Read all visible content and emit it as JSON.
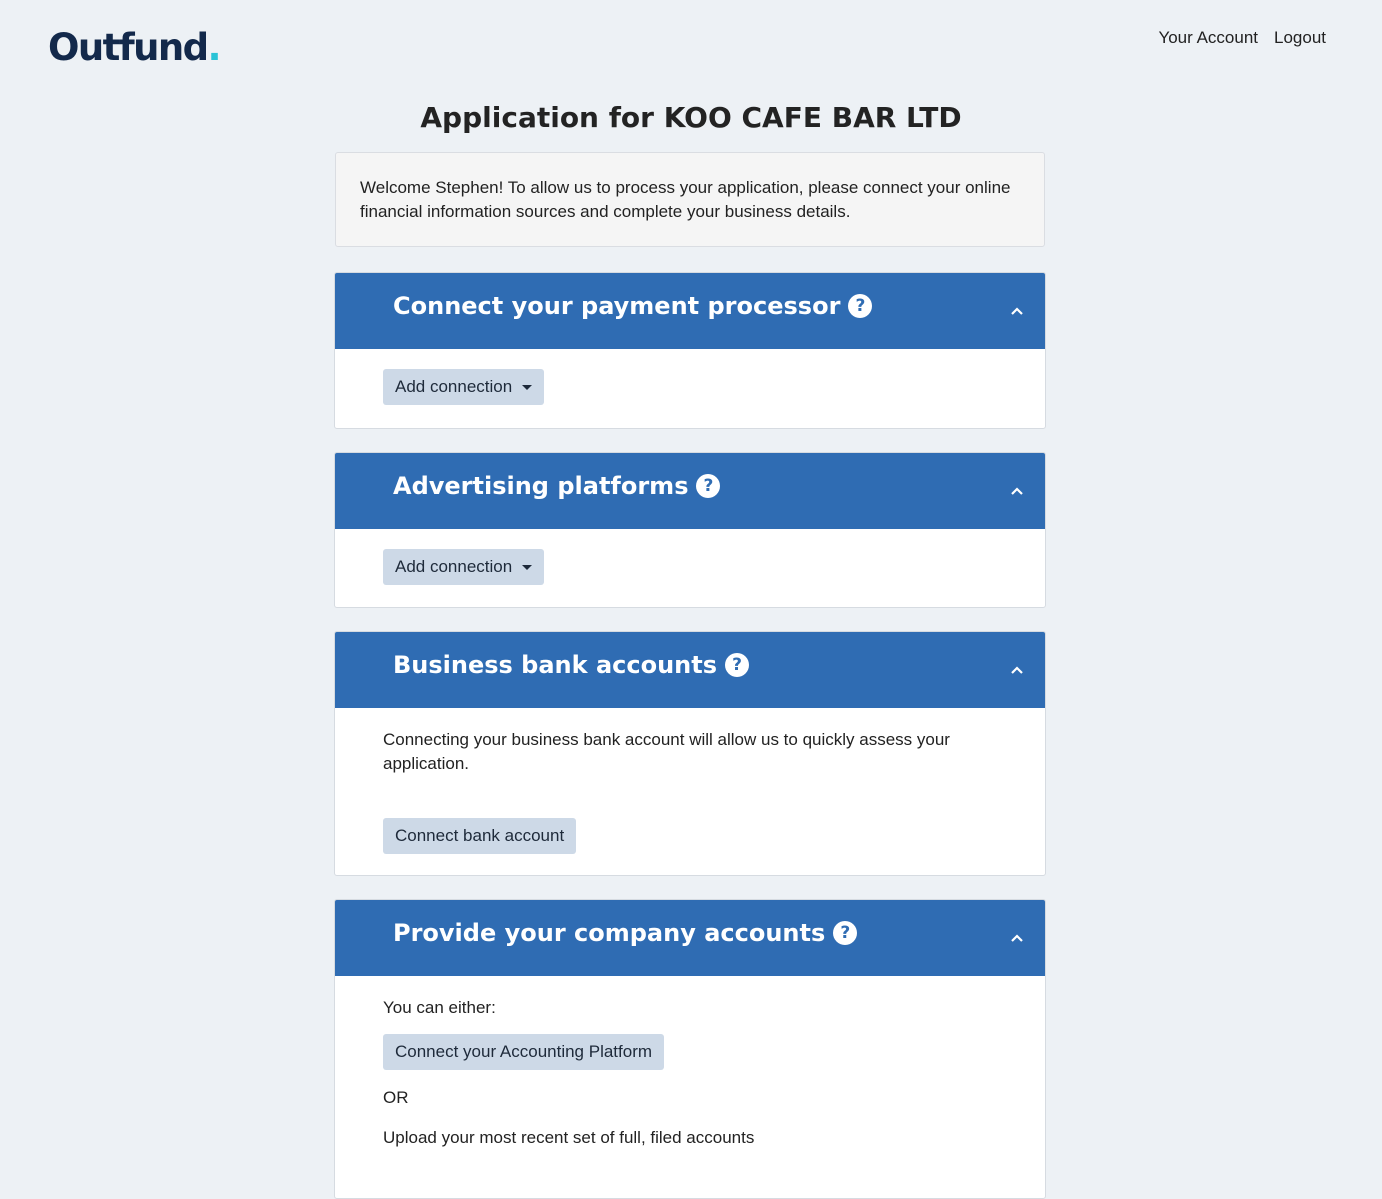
{
  "brand": {
    "logo_text": "Outfund",
    "logo_dot": "."
  },
  "nav": {
    "account": "Your Account",
    "logout": "Logout"
  },
  "page": {
    "title": "Application for KOO CAFE BAR LTD"
  },
  "welcome": {
    "text": "Welcome Stephen! To allow us to process your application, please connect your online financial information sources and complete your business details."
  },
  "sections": {
    "payment": {
      "title": "Connect your payment processor",
      "button": "Add connection"
    },
    "advertising": {
      "title": "Advertising platforms",
      "button": "Add connection"
    },
    "bank": {
      "title": "Business bank accounts",
      "description": "Connecting your business bank account will allow us to quickly assess your application.",
      "button": "Connect bank account"
    },
    "accounts": {
      "title": "Provide your company accounts",
      "intro": "You can either:",
      "button": "Connect your Accounting Platform",
      "or": "OR",
      "upload": "Upload your most recent set of full, filed accounts"
    }
  },
  "icons": {
    "help": "question-circle-icon",
    "chevron": "chevron-up-icon",
    "caret": "caret-down-icon"
  },
  "colors": {
    "header": "#2f6cb3",
    "button": "#cdd9e7",
    "background": "#edf1f5",
    "brand_dot": "#29c3d6",
    "brand": "#13294b"
  }
}
